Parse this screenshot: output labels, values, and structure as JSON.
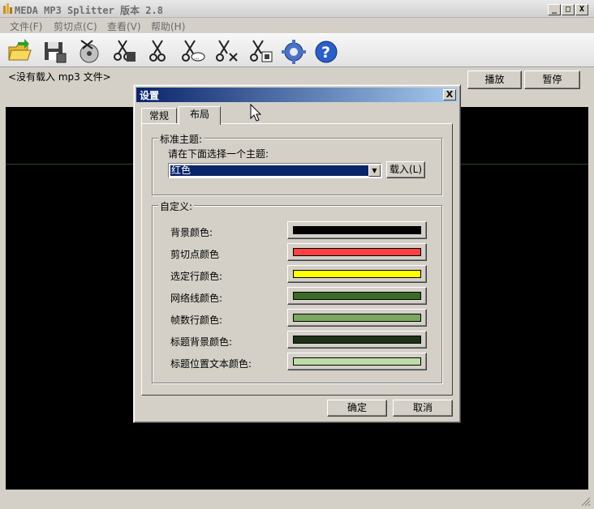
{
  "window": {
    "title": "MEDA MP3 Splitter 版本 2.8",
    "minimize": "_",
    "maximize": "□",
    "close": "X"
  },
  "menu": [
    {
      "label": "文件(F)"
    },
    {
      "label": "剪切点(C)"
    },
    {
      "label": "查看(V)"
    },
    {
      "label": "帮助(H)"
    }
  ],
  "toolbar": {
    "icons": [
      "open-folder-icon",
      "save-icon",
      "split-disc-icon",
      "cut-save-icon",
      "scissors-icon",
      "cut-comment-icon",
      "cut-delete-icon",
      "cut-export-icon",
      "settings-gear-icon",
      "help-icon"
    ]
  },
  "player": {
    "status": "<没有载入 mp3 文件>",
    "play_label": "播放",
    "pause_label": "暂停"
  },
  "dialog": {
    "title": "设置",
    "close": "X",
    "tabs": [
      {
        "label": "常规",
        "active": false
      },
      {
        "label": "布局",
        "active": true
      }
    ],
    "theme_group": {
      "title": "标准主题:",
      "prompt": "请在下面选择一个主题:",
      "selected": "红色",
      "load_label": "载入(L)"
    },
    "custom_group": {
      "title": "自定义:",
      "colors": [
        {
          "label": "背景颜色:",
          "color": "#000000"
        },
        {
          "label": "剪切点颜色",
          "color": "#ff4040"
        },
        {
          "label": "选定行颜色:",
          "color": "#ffff00"
        },
        {
          "label": "网络线颜色:",
          "color": "#3c6b28"
        },
        {
          "label": "帧数行颜色:",
          "color": "#7aa860"
        },
        {
          "label": "标题背景颜色:",
          "color": "#1e3218"
        },
        {
          "label": "标题位置文本颜色:",
          "color": "#c0dca8"
        }
      ]
    },
    "ok_label": "确定",
    "cancel_label": "取消"
  }
}
